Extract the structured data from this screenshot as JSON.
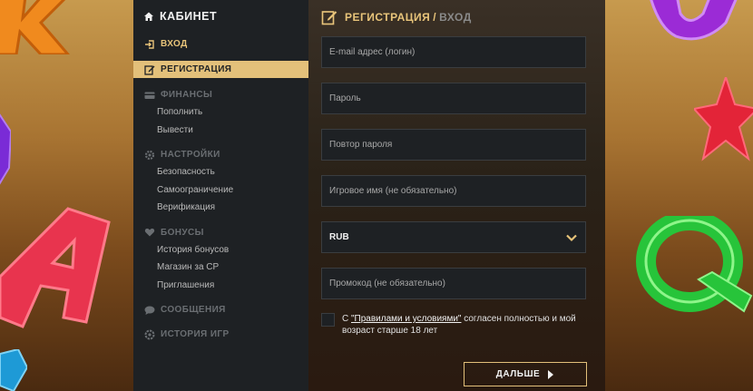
{
  "sidebar": {
    "title": "КАБИНЕТ",
    "login": "ВХОД",
    "register": "РЕГИСТРАЦИЯ",
    "finance": {
      "label": "ФИНАНСЫ",
      "items": [
        "Пополнить",
        "Вывести"
      ]
    },
    "settings": {
      "label": "НАСТРОЙКИ",
      "items": [
        "Безопасность",
        "Самоограничение",
        "Верификация"
      ]
    },
    "bonuses": {
      "label": "БОНУСЫ",
      "items": [
        "История бонусов",
        "Магазин за СР",
        "Приглашения"
      ]
    },
    "messages": "СООБЩЕНИЯ",
    "game_history": "ИСТОРИЯ ИГР"
  },
  "main": {
    "title_active": "РЕГИСТРАЦИЯ",
    "title_sep": "/",
    "title_inactive": "ВХОД",
    "fields": {
      "email_placeholder": "E-mail адрес (логин)",
      "password_placeholder": "Пароль",
      "password_repeat_placeholder": "Повтор пароля",
      "nickname_placeholder": "Игровое имя (не обязательно)",
      "currency_value": "RUB",
      "promo_placeholder": "Промокод (не обязательно)"
    },
    "agree": {
      "prefix": "С ",
      "link": "\"Правилами и условиями\"",
      "suffix": " согласен полностью и мой возраст старше 18 лет"
    },
    "next_button": "ДАЛЬШЕ"
  },
  "icons": {
    "home": "home-icon",
    "login": "login-icon",
    "edit": "edit-icon",
    "card": "card-icon",
    "gear": "gear-icon",
    "heart": "heart-icon",
    "chat": "chat-icon",
    "history": "history-icon",
    "chevron": "chevron-down-icon",
    "arrow": "caret-right-icon"
  },
  "colors": {
    "accent": "#e3c07a",
    "panel": "#1e2124",
    "text_muted": "#6a6e72"
  }
}
